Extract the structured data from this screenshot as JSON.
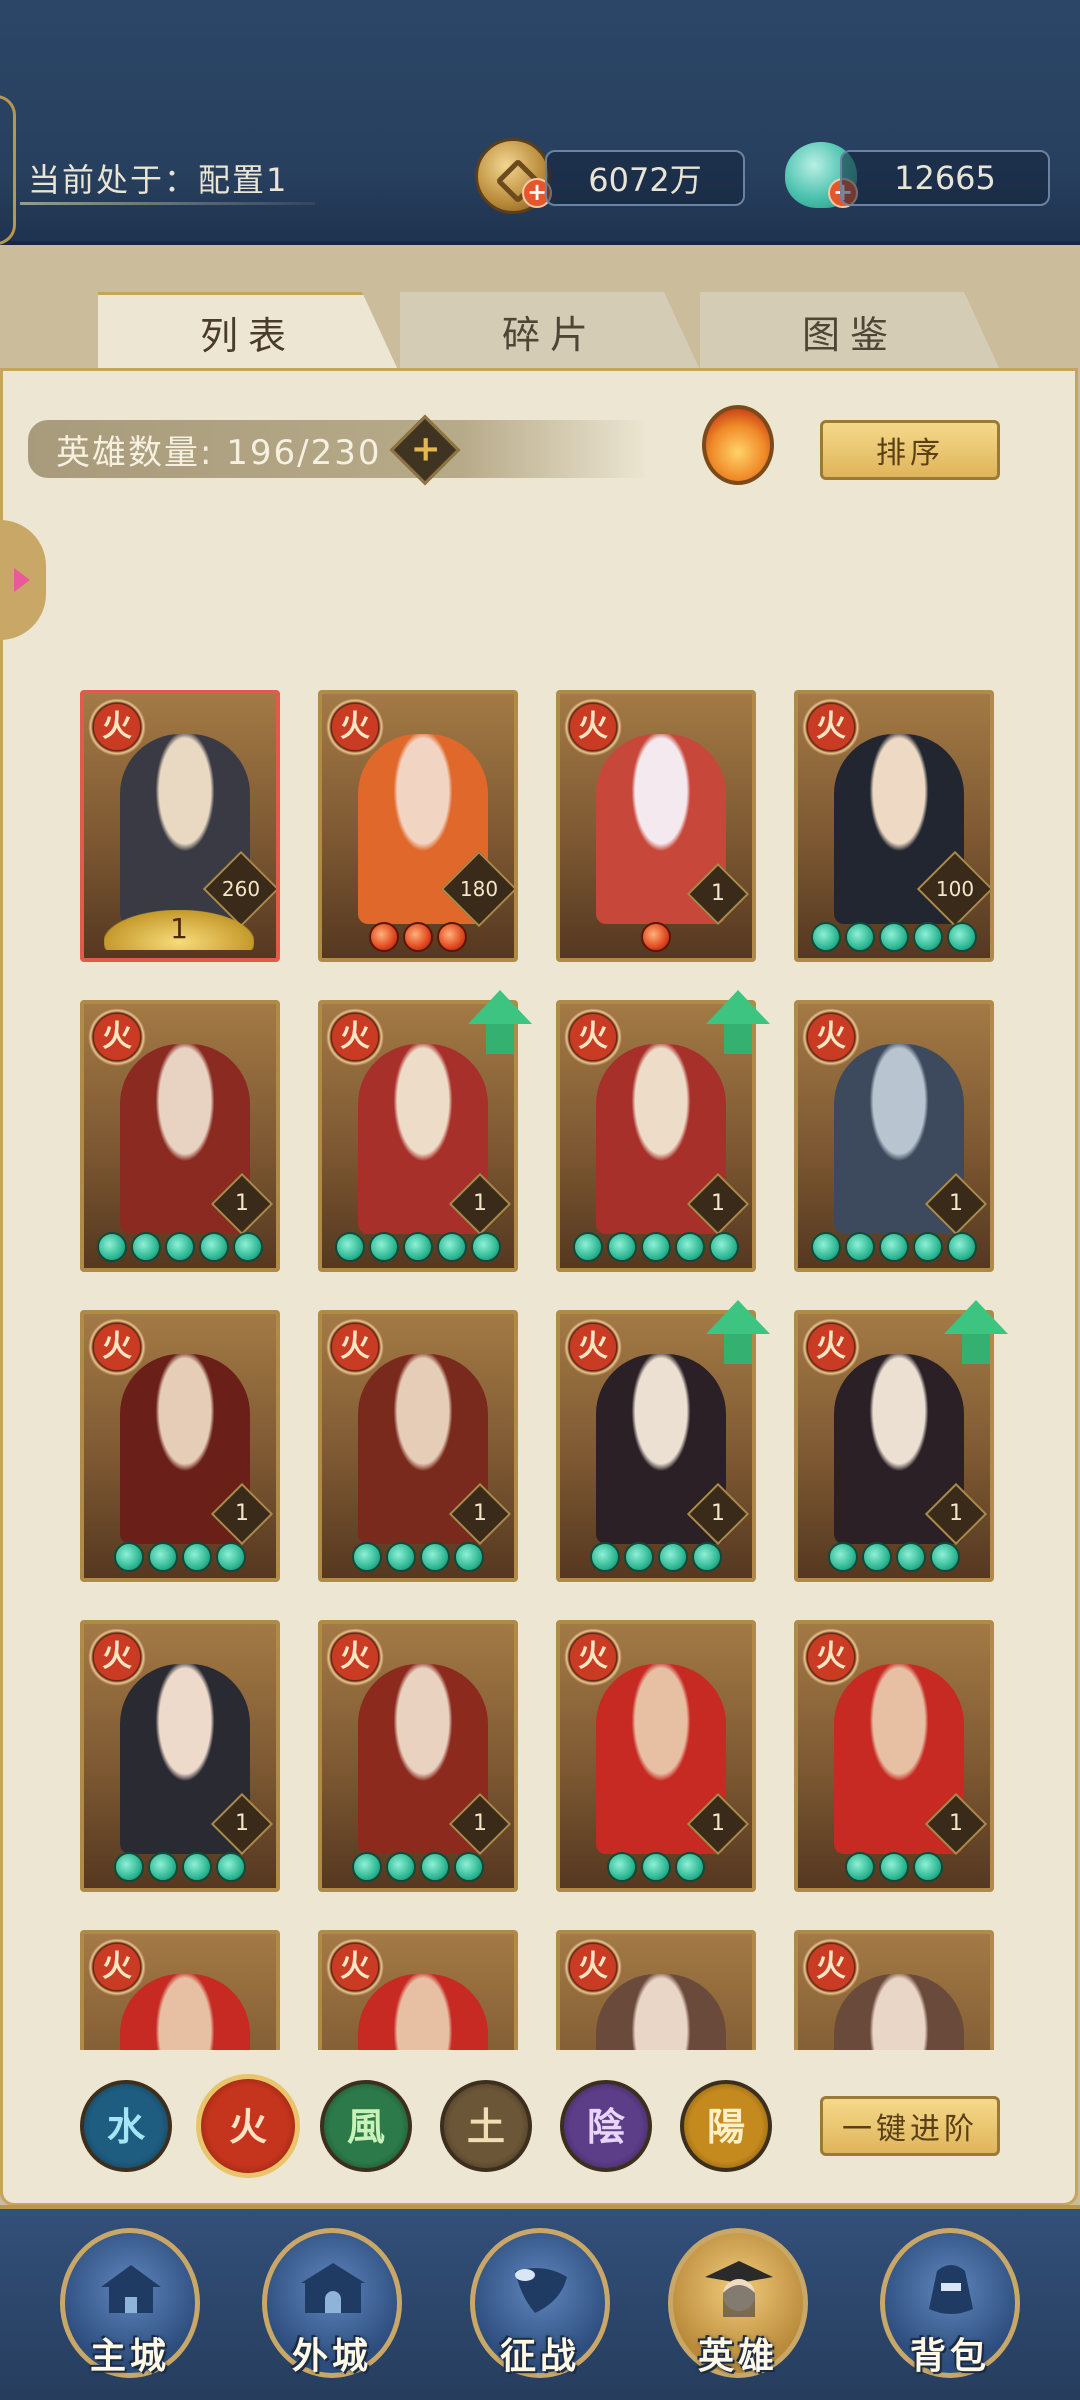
{
  "header": {
    "config_label": "当前处于：配置1",
    "coins": "6072万",
    "jade": "12665"
  },
  "tabs": [
    {
      "label": "列表",
      "active": true
    },
    {
      "label": "碎片",
      "active": false
    },
    {
      "label": "图鉴",
      "active": false
    }
  ],
  "hero_count": "英雄数量: 196/230",
  "sort_label": "排序",
  "promote_label": "一键进阶",
  "element_filters": [
    {
      "name": "water",
      "glyph": "水"
    },
    {
      "name": "fire",
      "glyph": "火",
      "selected": true
    },
    {
      "name": "wind",
      "glyph": "風"
    },
    {
      "name": "earth",
      "glyph": "土"
    },
    {
      "name": "yin",
      "glyph": "陰"
    },
    {
      "name": "yang",
      "glyph": "陽"
    }
  ],
  "element_glyph": "火",
  "heroes": [
    {
      "level": "260",
      "stars": 0,
      "crown": "1",
      "selected": true
    },
    {
      "level": "180",
      "stars": 3,
      "star_color": "red"
    },
    {
      "level": "1",
      "stars": 1,
      "star_color": "red"
    },
    {
      "level": "100",
      "stars": 5
    },
    {
      "level": "1",
      "stars": 5
    },
    {
      "level": "1",
      "stars": 5,
      "upgrade": true
    },
    {
      "level": "1",
      "stars": 5,
      "upgrade": true
    },
    {
      "level": "1",
      "stars": 5
    },
    {
      "level": "1",
      "stars": 4
    },
    {
      "level": "1",
      "stars": 4
    },
    {
      "level": "1",
      "stars": 4,
      "upgrade": true
    },
    {
      "level": "1",
      "stars": 4,
      "upgrade": true
    },
    {
      "level": "1",
      "stars": 4
    },
    {
      "level": "1",
      "stars": 4
    },
    {
      "level": "1",
      "stars": 3
    },
    {
      "level": "1",
      "stars": 3
    },
    {
      "level": "",
      "stars": 0
    },
    {
      "level": "",
      "stars": 0
    },
    {
      "level": "",
      "stars": 0
    },
    {
      "level": "",
      "stars": 0
    }
  ],
  "nav": [
    {
      "label": "主城"
    },
    {
      "label": "外城"
    },
    {
      "label": "征战"
    },
    {
      "label": "英雄",
      "active": true
    },
    {
      "label": "背包"
    }
  ],
  "colors": {
    "topbar": "#2c4668",
    "panel": "#ece6d2",
    "gold_border": "#c6a45b",
    "jade_star": "#2fb894",
    "fire_red": "#c93c23"
  }
}
